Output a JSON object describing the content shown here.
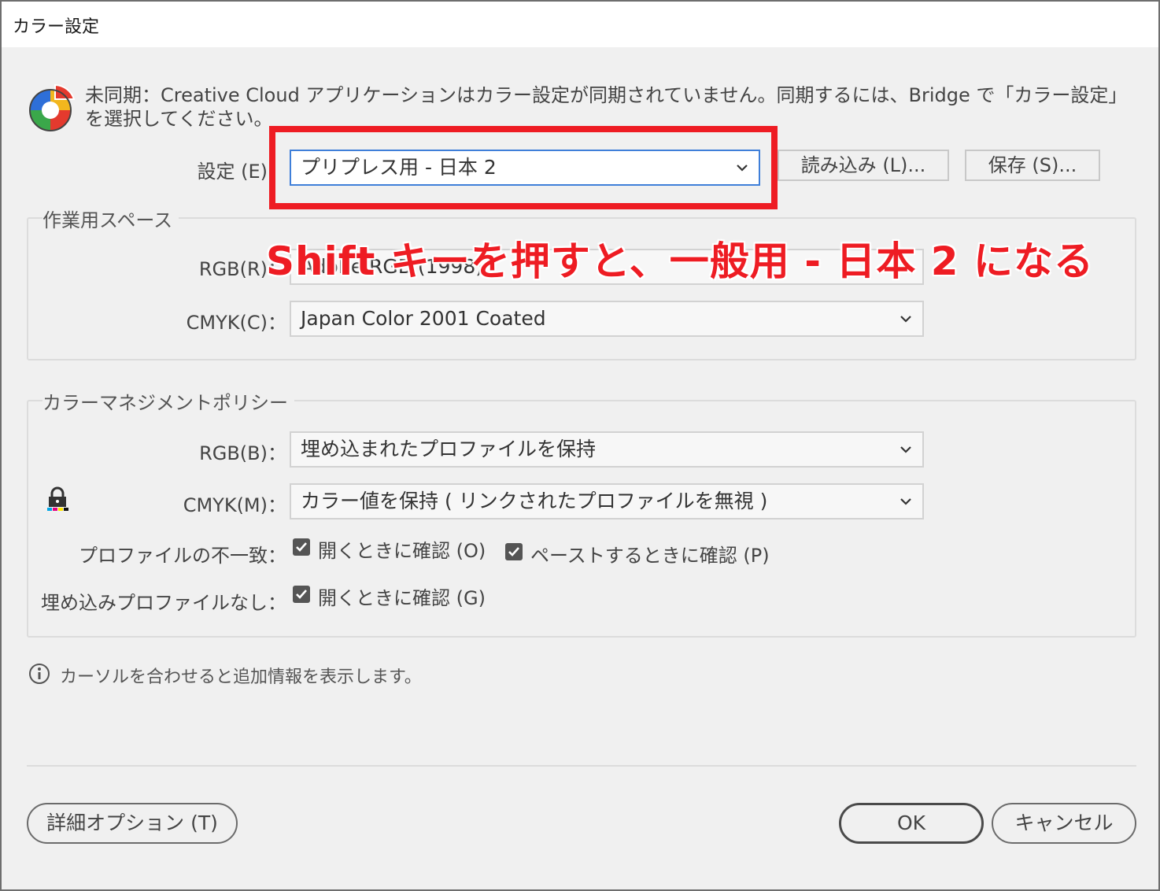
{
  "window": {
    "title": "カラー設定"
  },
  "sync": {
    "message": "未同期：Creative Cloud アプリケーションはカラー設定が同期されていません。同期するには、Bridge で「カラー設定」を選択してください。",
    "icon": "color-sync-icon"
  },
  "settings": {
    "label": "設定 (E)：",
    "value": "プリプレス用 - 日本 2",
    "load_button": "読み込み (L)...",
    "save_button": "保存 (S)..."
  },
  "working_spaces": {
    "title": "作業用スペース",
    "rgb_label": "RGB(R)：",
    "rgb_value": "Adobe RGB (1998)",
    "cmyk_label": "CMYK(C)：",
    "cmyk_value": "Japan Color 2001 Coated"
  },
  "policies": {
    "title": "カラーマネジメントポリシー",
    "rgb_label": "RGB(B)：",
    "rgb_value": "埋め込まれたプロファイルを保持",
    "cmyk_label": "CMYK(M)：",
    "cmyk_value": "カラー値を保持 ( リンクされたプロファイルを無視 )",
    "mismatch_label": "プロファイルの不一致：",
    "mismatch_open": "開くときに確認 (O)",
    "mismatch_paste": "ペーストするときに確認 (P)",
    "missing_label": "埋め込みプロファイルなし：",
    "missing_open": "開くときに確認 (G)"
  },
  "info": {
    "text": "カーソルを合わせると追加情報を表示します。"
  },
  "footer": {
    "advanced_button": "詳細オプション (T)",
    "ok_button": "OK",
    "cancel_button": "キャンセル"
  },
  "annotation": {
    "text": "Shift キーを押すと、一般用 - 日本 2 になる"
  },
  "colors": {
    "annotation_red": "#ee1c23",
    "focus_blue": "#3f7fd9"
  }
}
